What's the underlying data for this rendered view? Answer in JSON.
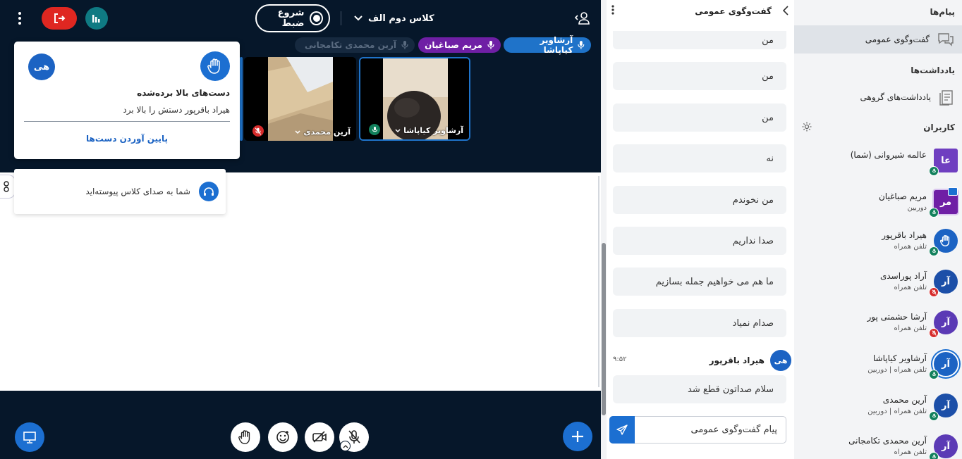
{
  "colors": {
    "main_bg": "#06172a",
    "primary": "#1c6fd1",
    "danger": "#df2721",
    "purple": "#6f1fa5",
    "teal": "#0f7a83",
    "mic_green": "#12805c",
    "mic_red": "#d62b2b"
  },
  "top": {
    "record_label": "شروع ضبط",
    "room_name": "کلاس دوم الف"
  },
  "talking": [
    {
      "name": "آرشاویر کیاپاشا"
    },
    {
      "name": "مریم صباغیان"
    },
    {
      "name": "آرین محمدی تکامجانی"
    }
  ],
  "tiles": [
    {
      "name": "آرشاویر کیاپاشا",
      "mic": "on"
    },
    {
      "name": "آرین محمدی",
      "mic": "muted"
    }
  ],
  "raise_hand_popup": {
    "avatar": "هی",
    "title": "دست‌های بالا برده‌شده",
    "description": "هیراد باقرپور دستش را بالا برد",
    "lower_action": "پایین آوردن دست‌ها"
  },
  "audio_toast": {
    "text": "شما به صدای کلاس پیوسته‌اید"
  },
  "chat": {
    "title": "گفت‌وگوی عمومی",
    "messages": [
      "من",
      "من",
      "من",
      "نه",
      "من نخوندم",
      "صدا نداریم",
      "ما هم می خواهیم جمله بسازیم",
      "صدام نمیاد"
    ],
    "last_author": {
      "initials": "هی",
      "name": "هیراد باقرپور",
      "time": "۹:۵۲"
    },
    "last_message": "سلام صداتون قطع شد",
    "input_placeholder": "پیام گفت‌وگوی عمومی"
  },
  "sidebar": {
    "messages_heading": "پیام‌ها",
    "public_chat_label": "گفت‌وگوی عمومی",
    "notes_heading": "یادداشت‌ها",
    "shared_notes_label": "یادداشت‌های گروهی",
    "users_heading": "کاربران",
    "users": [
      {
        "initials": "عا",
        "name": "عالمه شیروانی (شما)",
        "sub": "",
        "color": "#6f3fc0",
        "shape": "square",
        "mic": "on",
        "icon": "headphones"
      },
      {
        "initials": "مر",
        "name": "مریم صباغیان",
        "sub": "دوربین",
        "color": "#6f1fa5",
        "shape": "square",
        "mic": "on",
        "icon": "presenter"
      },
      {
        "initials": "",
        "name": "هیراد باقرپور",
        "sub": "تلفن همراه",
        "color": "#1c63c3",
        "shape": "circle",
        "mic": "on",
        "icon": "hand"
      },
      {
        "initials": "آر",
        "name": "آراد پوراسدی",
        "sub": "تلفن همراه",
        "color": "#1c4fa8",
        "shape": "circle",
        "mic": "muted",
        "icon": "none"
      },
      {
        "initials": "آر",
        "name": "آرشا حشمتی پور",
        "sub": "تلفن همراه",
        "color": "#5b3ab5",
        "shape": "circle",
        "mic": "muted",
        "icon": "none"
      },
      {
        "initials": "آر",
        "name": "آرشاویر کیاپاشا",
        "sub": "تلفن همراه | دوربین",
        "color": "#1c63c3",
        "shape": "circle",
        "mic": "on",
        "icon": "talking"
      },
      {
        "initials": "آر",
        "name": "آرین محمدی",
        "sub": "تلفن همراه | دوربین",
        "color": "#1c4fa8",
        "shape": "circle",
        "mic": "on",
        "icon": "none"
      },
      {
        "initials": "آر",
        "name": "آرین محمدی تکامجانی",
        "sub": "تلفن همراه",
        "color": "#5b3ab5",
        "shape": "circle",
        "mic": "on",
        "icon": "none"
      }
    ]
  }
}
